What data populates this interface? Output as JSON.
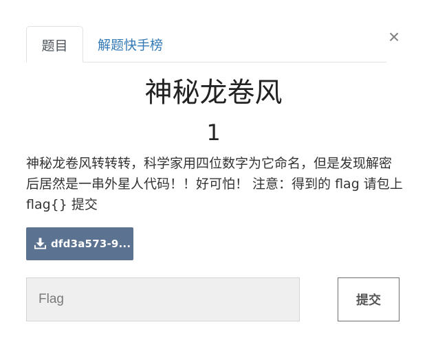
{
  "modal": {
    "close_label": "×"
  },
  "tabs": [
    {
      "label": "题目",
      "active": true
    },
    {
      "label": "解题快手榜",
      "active": false
    }
  ],
  "challenge": {
    "title": "神秘龙卷风",
    "points": "1",
    "description": "神秘龙卷风转转转，科学家用四位数字为它命名，但是发现解密后居然是一串外星人代码！！好可怕！ 注意：得到的 flag 请包上 flag{} 提交",
    "file_label": "dfd3a573-9..."
  },
  "submission": {
    "placeholder": "Flag",
    "value": "",
    "submit_label": "提交"
  },
  "icons": {
    "download": "download-icon",
    "close": "close-icon"
  },
  "colors": {
    "accent_link": "#337ab7",
    "download_button": "#5b7290",
    "input_background": "#efefef"
  }
}
